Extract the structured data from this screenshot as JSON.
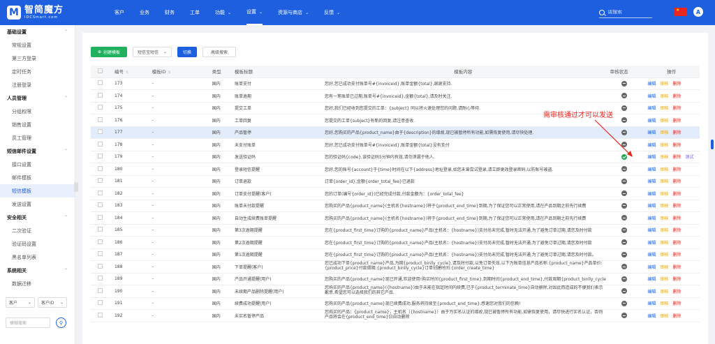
{
  "app": {
    "logo_mark": "M",
    "logo_name": "智简魔方",
    "logo_sub": "IDCSmart.com",
    "search_placeholder": "请搜索",
    "avatar_letter": "A"
  },
  "nav": [
    {
      "label": "客户",
      "active": false,
      "has_chevron": false
    },
    {
      "label": "业务",
      "active": false,
      "has_chevron": false
    },
    {
      "label": "财务",
      "active": false,
      "has_chevron": false
    },
    {
      "label": "工单",
      "active": false,
      "has_chevron": false
    },
    {
      "label": "功能",
      "active": false,
      "has_chevron": true
    },
    {
      "label": "设置",
      "active": true,
      "has_chevron": true
    },
    {
      "label": "资源与商店",
      "active": false,
      "has_chevron": true
    },
    {
      "label": "反馈",
      "active": false,
      "has_chevron": true
    }
  ],
  "sidebar": {
    "groups": [
      {
        "title": "基础设置",
        "items": [
          "常规设置",
          "第三方登录",
          "定时任务",
          "注册登录"
        ]
      },
      {
        "title": "人员管理",
        "items": [
          "分组权限",
          "销售设置",
          "员工管理"
        ]
      },
      {
        "title": "短信邮件设置",
        "items": [
          "接口设置",
          "邮件模板",
          "短信模板",
          "发送设置"
        ]
      },
      {
        "title": "安全相关",
        "items": [
          "二次验证",
          "验证码设置",
          "黑名单列表"
        ]
      },
      {
        "title": "系统相关",
        "items": [
          "数据迁移"
        ]
      }
    ],
    "active_item": "短信模板",
    "filter": {
      "select1": "客户",
      "select2": "客户ID",
      "search_placeholder": "模糊搜索"
    }
  },
  "toolbar": {
    "create_label": "创建模板",
    "select_label": "短信宝短信",
    "switch_label": "切换",
    "advanced_label": "高级搜索"
  },
  "table": {
    "headers": [
      "编号",
      "模板ID",
      "类型",
      "模板标题",
      "模板内容",
      "审核状态",
      "操作"
    ],
    "actions": {
      "edit": "编辑",
      "review": "审核",
      "delete": "删除",
      "test": "测试"
    },
    "rows": [
      {
        "id": "173",
        "tid": "-",
        "type": "国内",
        "title": "账单支付",
        "content": "您好,您已成功支付账单号#{invoiceid},账单金额{total},谢谢支持.",
        "status": "grey"
      },
      {
        "id": "174",
        "tid": "-",
        "type": "国内",
        "title": "账单逾期",
        "content": "您有一笔账单已过期,账单号#{invoiceid},金额{total},请及时关注.",
        "status": "grey"
      },
      {
        "id": "175",
        "tid": "-",
        "type": "国内",
        "title": "提交工单",
        "content": "您好,我们已经收到您提交的工单：{subject} 同以将火速处理您的问题,请耐心等待.",
        "status": "grey"
      },
      {
        "id": "176",
        "tid": "-",
        "type": "国内",
        "title": "工单回复",
        "content": "您提交的工单{subject}有新的回复,请注意查收.",
        "status": "grey"
      },
      {
        "id": "177",
        "tid": "-",
        "type": "国内",
        "title": "产品暂停",
        "content": "您好,您购买的产品{product_name}由于{description}的缘故,现已被暂停所有功能,如需恢复使用,请尽快处理.",
        "status": "grey",
        "highlight": true
      },
      {
        "id": "178",
        "tid": "-",
        "type": "国内",
        "title": "未支付账单",
        "content": "您好,您已成功支付账单号#{invoiceid},账单金额{total}没有支付",
        "status": "grey"
      },
      {
        "id": "179",
        "tid": "-",
        "type": "国内",
        "title": "发送验证码",
        "content": "您的验证码{code},该验证码5分钟内有效,请勿泄漏于他人.",
        "status": "green",
        "test": true
      },
      {
        "id": "180",
        "tid": "-",
        "type": "国内",
        "title": "登录短信提醒",
        "content": "您好,您的账号{account}于{time}时间在以下{address}地址登录,如您未曾尝试登录,请立即更改登录密码,以防账号被盗.",
        "status": "grey"
      },
      {
        "id": "181",
        "tid": "-",
        "type": "国内",
        "title": "订单退款",
        "content": "订单{order_id},金额{order_total_fee}已退款",
        "status": "grey"
      },
      {
        "id": "182",
        "tid": "-",
        "type": "国内",
        "title": "订单支付提醒(客户)",
        "content": "您的订单(编号{order_id})已经完成付款,付款金额为：{order_total_fee}",
        "status": "grey"
      },
      {
        "id": "183",
        "tid": "-",
        "type": "国内",
        "title": "账单未付款提醒",
        "content": "您购买的产品{product_name}(主机名{hostname})将于{product_end_time}到期,为了保证您可以正常使用,请在产品到期之前先行续费",
        "status": "grey"
      },
      {
        "id": "184",
        "tid": "-",
        "type": "国内",
        "title": "自动生成续费账单提醒",
        "content": "您购买的产品{product_name}(主机名{hostname})将于{product_end_time}到期,为了保证您可以正常使用,请在产品到期之前先行续费",
        "status": "grey"
      },
      {
        "id": "185",
        "tid": "-",
        "type": "国内",
        "title": "第3次逾期提醒",
        "content": "您在{product_first_time}订购的{product_name}产品(主机名：{hostname})支付尚未完成,暂时无法开通,为了避免订单过期,请您及时付款",
        "status": "grey"
      },
      {
        "id": "186",
        "tid": "-",
        "type": "国内",
        "title": "第2次逾期提醒",
        "content": "您在{product_first_time}订购的{product_name}产品(主机名：{hostname})支付尚未完成,暂时无法开通,为了避免订单过期,请您及时付款",
        "status": "grey"
      },
      {
        "id": "187",
        "tid": "-",
        "type": "国内",
        "title": "第1次逾期提醒",
        "content": "您在{product_first_time}订购的{product_name}产品(主机名：{hostname})支付尚未完成,暂时无法开通,为了避免订单过期,请您及时付款。",
        "status": "grey"
      },
      {
        "id": "188",
        "tid": "-",
        "type": "国内",
        "title": "下单提醒(客户)",
        "content": "您已成功下单{product_name}产品,为期{product_binlly_cycle},请及时付款,以免订单失效,以下为账单信息产品名称:{product_name}产品单价:{product_price}付款周期:{product_binlly_cycle}订单创建时间:{order_create_time}",
        "status": "grey",
        "wrap": true
      },
      {
        "id": "189",
        "tid": "-",
        "type": "国内",
        "title": "产品开通提醒(用户)",
        "content": "您购买的产品{product_name}现已开通,欢迎使用!购买时间{product_first_time},到期时间{product_end_time},付款周期{product_binlly_cycle}",
        "status": "grey"
      },
      {
        "id": "190",
        "tid": "-",
        "type": "国内",
        "title": "未续期产品删除提醒(用户)",
        "content": "您购买的产品{product_name}({hostname})由于未能在指定时间内续费,已于{product_terminate_time}自动删除,对因此而造成的不便我们表示歉意,希望您可以选择我们的其它产品.",
        "status": "grey",
        "wrap": true
      },
      {
        "id": "191",
        "tid": "-",
        "type": "国内",
        "title": "续费成功提醒(用户)",
        "content": "您购买的产品{product_name}现已续费成功,服务将持续至{product_end_time},感谢您对我们的信赖!",
        "status": "grey"
      },
      {
        "id": "192",
        "tid": "-",
        "type": "国内",
        "title": "未实名暂停产品",
        "content": "您购买的产品：{product_name}，主机名（{hostname}）由于为实名认证的缘故,现已被暂停所有功能,如需恢复使用，请尽快进行实名认证，否则产品将会在{product_end_time}日自动删除",
        "status": "grey",
        "wrap": true
      }
    ]
  },
  "annotation": {
    "text": "需审核通过才可以发送",
    "color": "#e8261e"
  },
  "colors": {
    "primary": "#1e5fe0",
    "success": "#20b15e",
    "danger": "#e8261e",
    "warning": "#e8a317"
  }
}
